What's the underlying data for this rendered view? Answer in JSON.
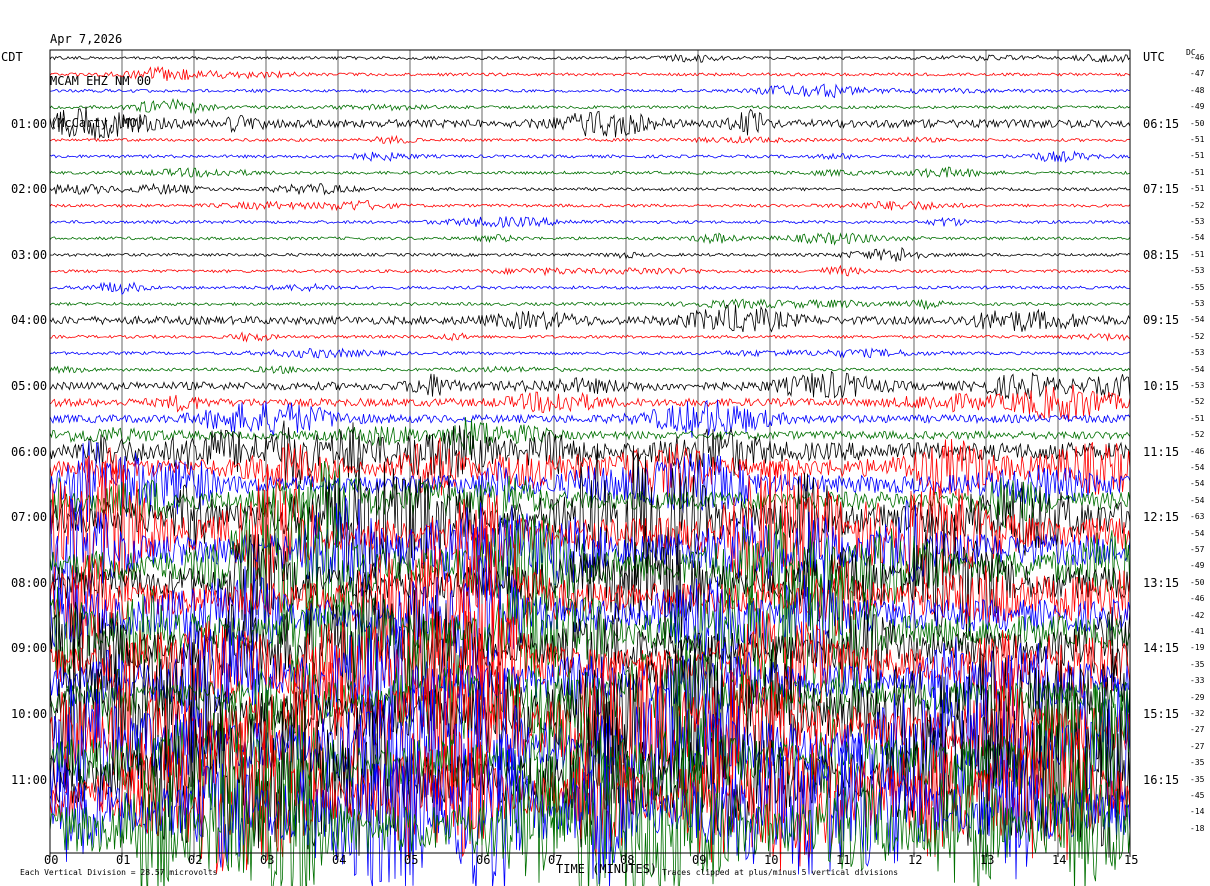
{
  "header": {
    "date": "Apr 7,2026",
    "station": "MCAM EHZ NM 00",
    "location": "(McCarty, MO)"
  },
  "labels": {
    "left_tz": "CDT",
    "right_tz": "UTC",
    "dc_header": "DC",
    "xlabel": "TIME (MINUTES)",
    "footer_left": "Each Vertical Division = 28.57 microvolts",
    "footer_right": "Traces clipped at plus/minus 5 vertical divisions"
  },
  "colors": {
    "trace_cycle": [
      "#000000",
      "#ff0000",
      "#0000ff",
      "#007000"
    ],
    "grid": "#000000"
  },
  "chart_data": {
    "type": "line",
    "title": "MCAM EHZ NM 00",
    "xlabel": "TIME (MINUTES)",
    "ylabel": "",
    "xlim": [
      0,
      15
    ],
    "x_ticks": [
      "00",
      "01",
      "02",
      "03",
      "04",
      "05",
      "06",
      "07",
      "08",
      "09",
      "10",
      "11",
      "12",
      "13",
      "14",
      "15"
    ],
    "cdt_hour_labels": [
      "01:00",
      "02:00",
      "03:00",
      "04:00",
      "05:00",
      "06:00",
      "07:00",
      "08:00",
      "09:00",
      "10:00",
      "11:00"
    ],
    "utc_hour_labels": [
      "06:15",
      "07:15",
      "08:15",
      "09:15",
      "10:15",
      "11:15",
      "12:15",
      "13:15",
      "14:15",
      "15:15",
      "16:15"
    ],
    "trace_count": 48,
    "dc_offsets": [
      -46,
      -47,
      -48,
      -49,
      -50,
      -51,
      -51,
      -51,
      -51,
      -52,
      -53,
      -54,
      -51,
      -53,
      -55,
      -53,
      -54,
      -52,
      -53,
      -54,
      -53,
      -52,
      -51,
      -52,
      -46,
      -54,
      -54,
      -54,
      -63,
      -54,
      -57,
      -49,
      -50,
      -46,
      -42,
      -41,
      -19,
      -35,
      -33,
      -29,
      -32,
      -27,
      -27,
      -35,
      -35,
      -45,
      -14,
      -18
    ],
    "amplitude_levels": [
      1,
      1,
      1,
      1,
      2,
      1,
      1,
      1,
      1,
      1,
      1,
      1,
      1,
      1,
      1,
      1,
      2,
      1,
      1,
      1,
      2,
      2,
      2,
      2,
      3,
      3,
      3,
      3,
      4,
      4,
      4,
      4,
      4,
      4,
      4,
      4,
      4,
      4,
      4,
      4,
      5,
      5,
      5,
      5,
      5,
      5,
      5,
      5
    ]
  }
}
